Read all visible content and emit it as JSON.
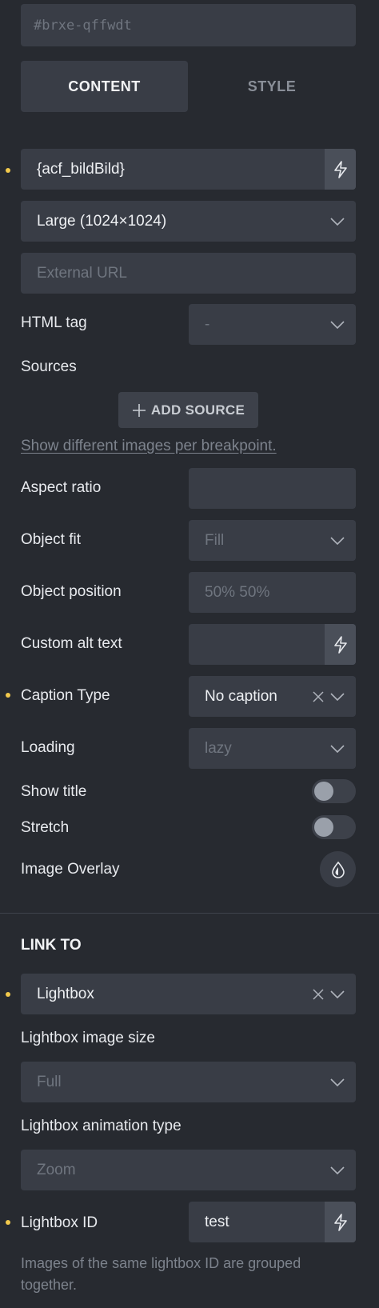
{
  "element_id": "#brxe-qffwdt",
  "tabs": [
    {
      "label": "CONTENT",
      "active": true
    },
    {
      "label": "STYLE",
      "active": false
    }
  ],
  "image": {
    "value": "{acf_bildBild}",
    "size": "Large (1024×1024)",
    "external_url_placeholder": "External URL"
  },
  "html_tag": {
    "label": "HTML tag",
    "value": "-"
  },
  "sources": {
    "label": "Sources",
    "add_button": "ADD SOURCE",
    "help_link": "Show different images per breakpoint."
  },
  "settings": {
    "aspect_ratio": {
      "label": "Aspect ratio",
      "value": ""
    },
    "object_fit": {
      "label": "Object fit",
      "value": "Fill"
    },
    "object_position": {
      "label": "Object position",
      "value": "50% 50%"
    },
    "custom_alt_text": {
      "label": "Custom alt text",
      "value": ""
    },
    "caption_type": {
      "label": "Caption Type",
      "value": "No caption"
    },
    "loading": {
      "label": "Loading",
      "value": "lazy"
    },
    "show_title": {
      "label": "Show title",
      "enabled": false
    },
    "stretch": {
      "label": "Stretch",
      "enabled": false
    },
    "image_overlay": {
      "label": "Image Overlay"
    }
  },
  "link_to": {
    "heading": "LINK TO",
    "value": "Lightbox",
    "lightbox_image_size": {
      "label": "Lightbox image size",
      "value": "Full"
    },
    "lightbox_animation_type": {
      "label": "Lightbox animation type",
      "value": "Zoom"
    },
    "lightbox_id": {
      "label": "Lightbox ID",
      "value": "test"
    },
    "help_text": "Images of the same lightbox ID are grouped together."
  },
  "colors": {
    "background": "#272a30",
    "field": "#393d46",
    "accent_dot": "#f2c94c"
  }
}
